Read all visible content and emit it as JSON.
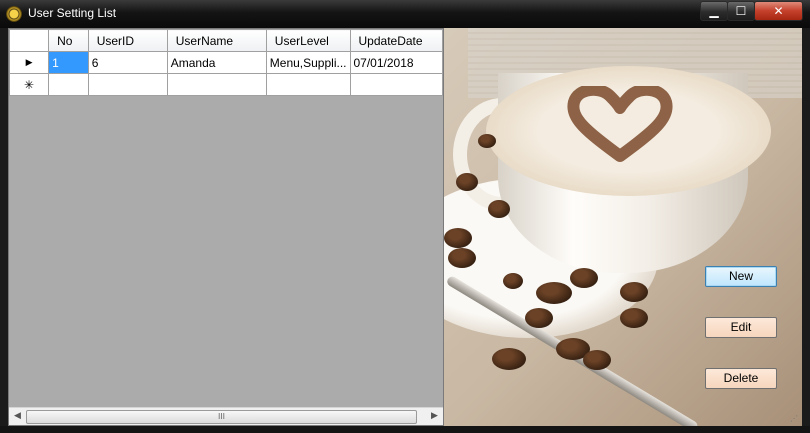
{
  "window": {
    "title": "User Setting List",
    "controls": {
      "minimize": "▁",
      "maximize": "☐",
      "close": "✕"
    }
  },
  "grid": {
    "columns": [
      "No",
      "UserID",
      "UserName",
      "UserLevel",
      "UpdateDate"
    ],
    "rows": [
      {
        "indicator": "▶",
        "No": "1",
        "UserID": "6",
        "UserName": "Amanda",
        "UserLevel": "Menu,Suppli...",
        "UpdateDate": "07/01/2018"
      }
    ],
    "new_row_indicator": "✳",
    "scroll_thumb": "III"
  },
  "buttons": {
    "new": "New",
    "edit": "Edit",
    "delete": "Delete"
  },
  "colors": {
    "selected_cell": "#3399ff",
    "grid_background": "#ababab",
    "close_button": "#c4402b"
  }
}
